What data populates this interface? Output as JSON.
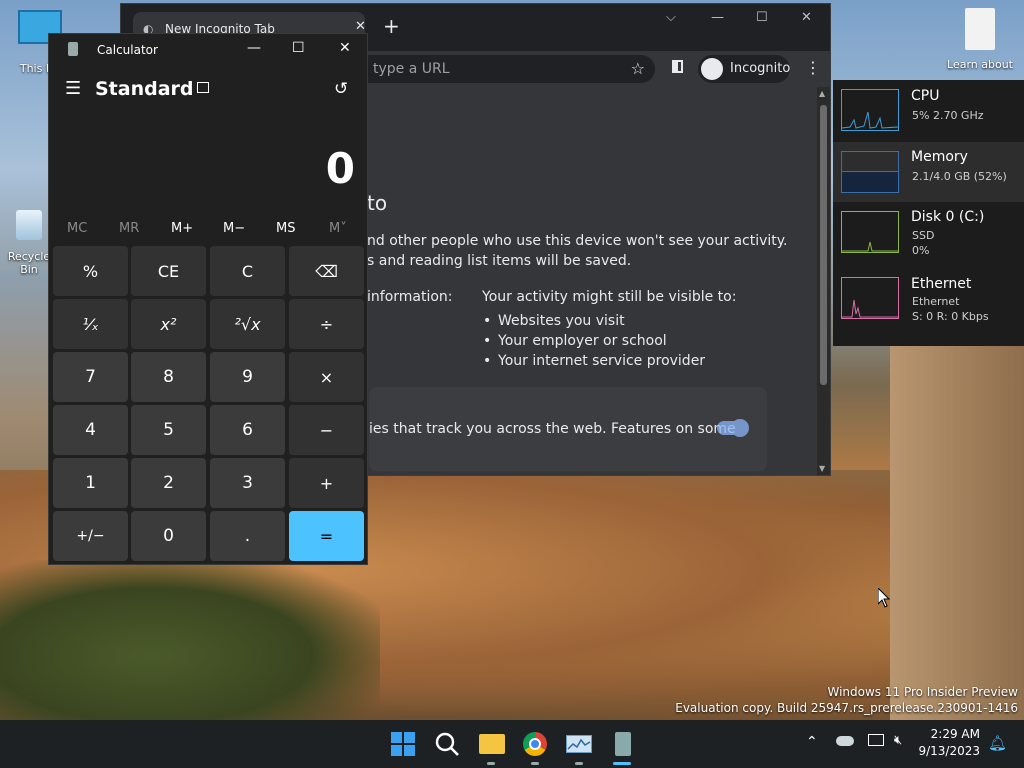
{
  "desktop": {
    "icons": [
      {
        "label": "This PC"
      },
      {
        "label": "Recycle Bin"
      },
      {
        "label": "Learn about"
      }
    ],
    "watermark_line1": "Windows 11 Pro Insider Preview",
    "watermark_line2": "Evaluation copy. Build 25947.rs_prerelease.230901-1416"
  },
  "chrome": {
    "tab_title": "New Incognito Tab",
    "omnibox_placeholder": "type a URL",
    "profile_label": "Incognito",
    "heading": "to",
    "line1": "nd other people who use this device won't see your activity.",
    "line2": "s and reading list items will be saved.",
    "info_label": "information:",
    "visible_heading": "Your activity might still be visible to:",
    "visible_items": [
      "Websites you visit",
      "Your employer or school",
      "Your internet service provider"
    ],
    "cookie_text": "ies that track you across the web. Features on some"
  },
  "taskmanager": {
    "cpu_title": "CPU",
    "cpu_sub": "5% 2.70 GHz",
    "mem_title": "Memory",
    "mem_sub": "2.1/4.0 GB (52%)",
    "disk_title": "Disk 0 (C:)",
    "disk_sub1": "SSD",
    "disk_sub2": "0%",
    "eth_title": "Ethernet",
    "eth_sub1": "Ethernet",
    "eth_sub2": "S: 0 R: 0 Kbps",
    "colors": {
      "cpu": "#3e9ed6",
      "memory": "#3e6ea8",
      "disk": "#8bb54a",
      "ethernet": "#d66fa8"
    }
  },
  "calculator": {
    "window_title": "Calculator",
    "mode": "Standard",
    "display": "0",
    "memory_buttons": [
      "MC",
      "MR",
      "M+",
      "M−",
      "MS",
      "M˅"
    ],
    "keys": [
      [
        "%",
        "CE",
        "C",
        "⌫"
      ],
      [
        "¹⁄ₓ",
        "x²",
        "²√x",
        "÷"
      ],
      [
        "7",
        "8",
        "9",
        "×"
      ],
      [
        "4",
        "5",
        "6",
        "−"
      ],
      [
        "1",
        "2",
        "3",
        "+"
      ],
      [
        "+/−",
        "0",
        ".",
        "="
      ]
    ],
    "accent": "#4cc2ff"
  },
  "taskbar": {
    "time": "2:29 AM",
    "date": "9/13/2023"
  }
}
